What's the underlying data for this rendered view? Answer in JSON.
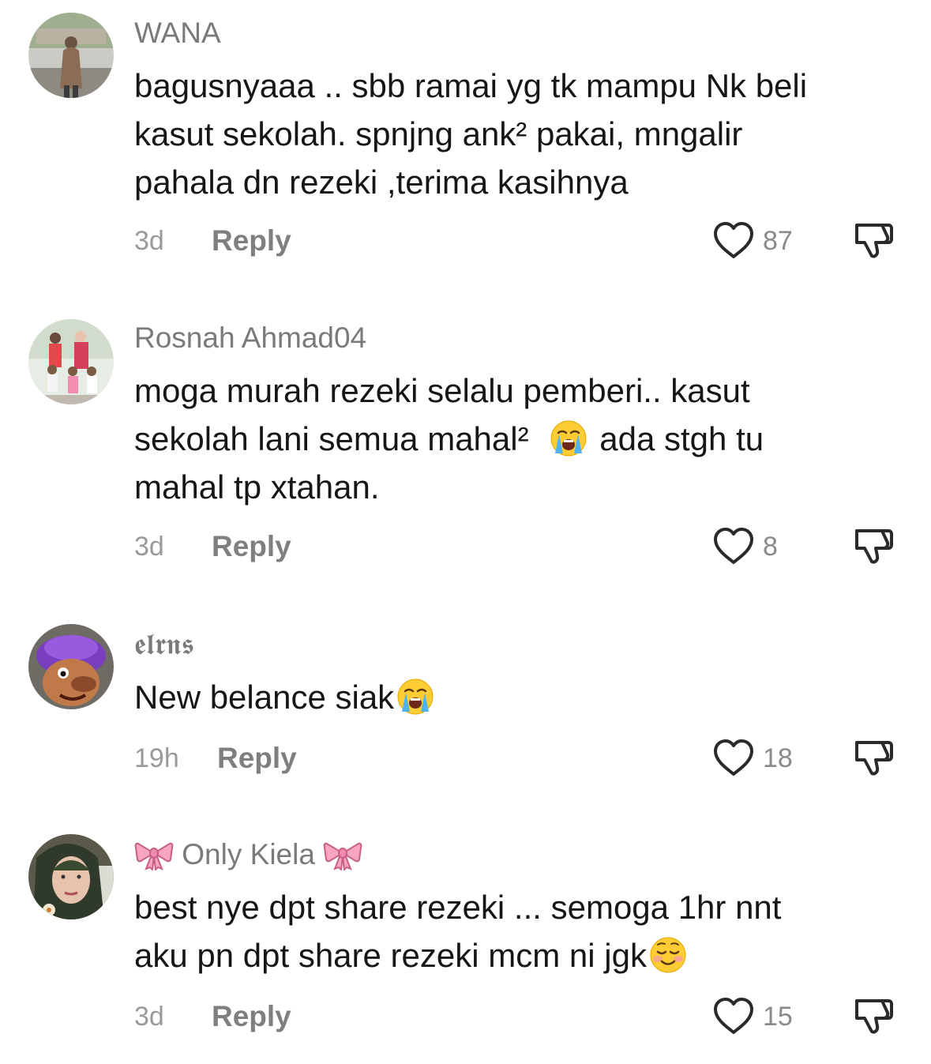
{
  "comments": [
    {
      "username": "WANA",
      "avatar": "woman-in-hijab-outdoor-photo",
      "lines": [
        "bagusnyaaa .. sbb ramai yg tk mampu Nk beli",
        "kasut sekolah. spnjng ank² pakai, mngalir",
        "pahala dn rezeki ,terima kasihnya"
      ],
      "time": "3d",
      "reply_label": "Reply",
      "likes": "87"
    },
    {
      "username": "Rosnah Ahmad04",
      "avatar": "family-group-photo",
      "line1": "moga murah rezeki selalu pemberi.. kasut",
      "line2_before": "sekolah lani semua mahal²",
      "line2_emoji": "loudly-crying-face",
      "line2_after": "ada stgh tu",
      "line3": "mahal tp xtahan.",
      "time": "3d",
      "reply_label": "Reply",
      "likes": "8"
    },
    {
      "username": "𝖊𝖑𝖗𝖓𝖘",
      "avatar": "puppet-with-purple-hat",
      "text": "New belance siak",
      "emoji": "loudly-crying-face",
      "time": "19h",
      "reply_label": "Reply",
      "likes": "18"
    },
    {
      "username": "Only Kiela",
      "username_decoration": "ribbon-bow",
      "avatar": "woman-with-floral-scarf",
      "line1": "best nye dpt share rezeki ... semoga 1hr nnt",
      "line2": "aku pn dpt share rezeki mcm ni jgk",
      "line2_emoji": "smiling-face",
      "time": "3d",
      "reply_label": "Reply",
      "likes": "15"
    }
  ],
  "icons": {
    "like": "heart-outline-icon",
    "dislike": "thumbs-down-outline-icon"
  },
  "colors": {
    "username": "#7a7a7a",
    "body": "#161616",
    "meta": "#9a9a9a",
    "reply": "#7f7f7f",
    "icon": "#2a2a2a"
  }
}
